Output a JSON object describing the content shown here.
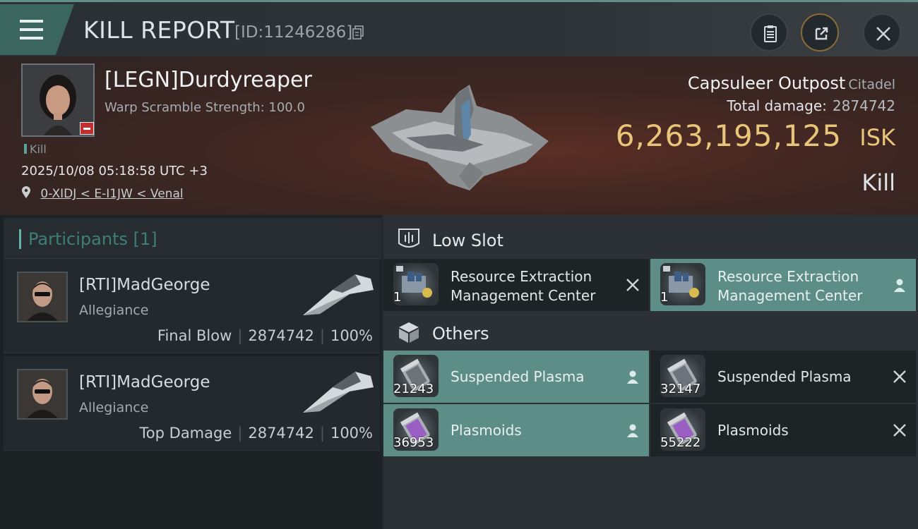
{
  "header": {
    "title": "KILL REPORT",
    "report_id": "[ID:11246286]"
  },
  "victim": {
    "name": "[LEGN]Durdyreaper",
    "subtitle": "Warp Scramble Strength: 100.0",
    "tag": "Kill",
    "datetime": "2025/10/08 05:18:58 UTC +3",
    "location": "0-XIDJ < E-I1JW < Venal",
    "structure_name": "Capsuleer Outpost",
    "structure_class": "Citadel",
    "total_damage_label": "Total damage:",
    "total_damage": "2874742",
    "isk_value": "6,263,195,125",
    "isk_unit": "ISK",
    "result": "Kill"
  },
  "participants": {
    "header": "Participants [1]",
    "items": [
      {
        "name": "[RTI]MadGeorge",
        "corp": "Allegiance",
        "role": "Final Blow",
        "damage": "2874742",
        "percent": "100%"
      },
      {
        "name": "[RTI]MadGeorge",
        "corp": "Allegiance",
        "role": "Top Damage",
        "damage": "2874742",
        "percent": "100%"
      }
    ]
  },
  "sections": {
    "low_slot": {
      "title": "Low Slot",
      "items": [
        {
          "name_line1": "Resource Extraction",
          "name_line2": "Management Center",
          "qty": "1",
          "status": "destroyed",
          "highlight": false
        },
        {
          "name_line1": "Resource Extraction",
          "name_line2": "Management Center",
          "qty": "1",
          "status": "dropped",
          "highlight": true
        }
      ]
    },
    "others": {
      "title": "Others",
      "items": [
        {
          "name": "Suspended Plasma",
          "qty": "21243",
          "status": "dropped",
          "highlight": true
        },
        {
          "name": "Suspended Plasma",
          "qty": "32147",
          "status": "destroyed",
          "highlight": false
        },
        {
          "name": "Plasmoids",
          "qty": "36953",
          "status": "dropped",
          "highlight": true
        },
        {
          "name": "Plasmoids",
          "qty": "55222",
          "status": "destroyed",
          "highlight": false
        }
      ]
    }
  },
  "colors": {
    "accent_teal": "#5c8d86",
    "isk_gold": "#e9c57a",
    "badge_red": "#c0302e"
  },
  "icons": {
    "menu": "hamburger-icon",
    "copy": "copy-icon",
    "clipboard": "clipboard-icon",
    "share": "share-icon",
    "close": "close-icon",
    "location": "location-pin-icon",
    "low_slot": "low-slot-icon",
    "others": "cube-icon",
    "dropped": "person-icon",
    "destroyed": "x-mark-icon"
  }
}
